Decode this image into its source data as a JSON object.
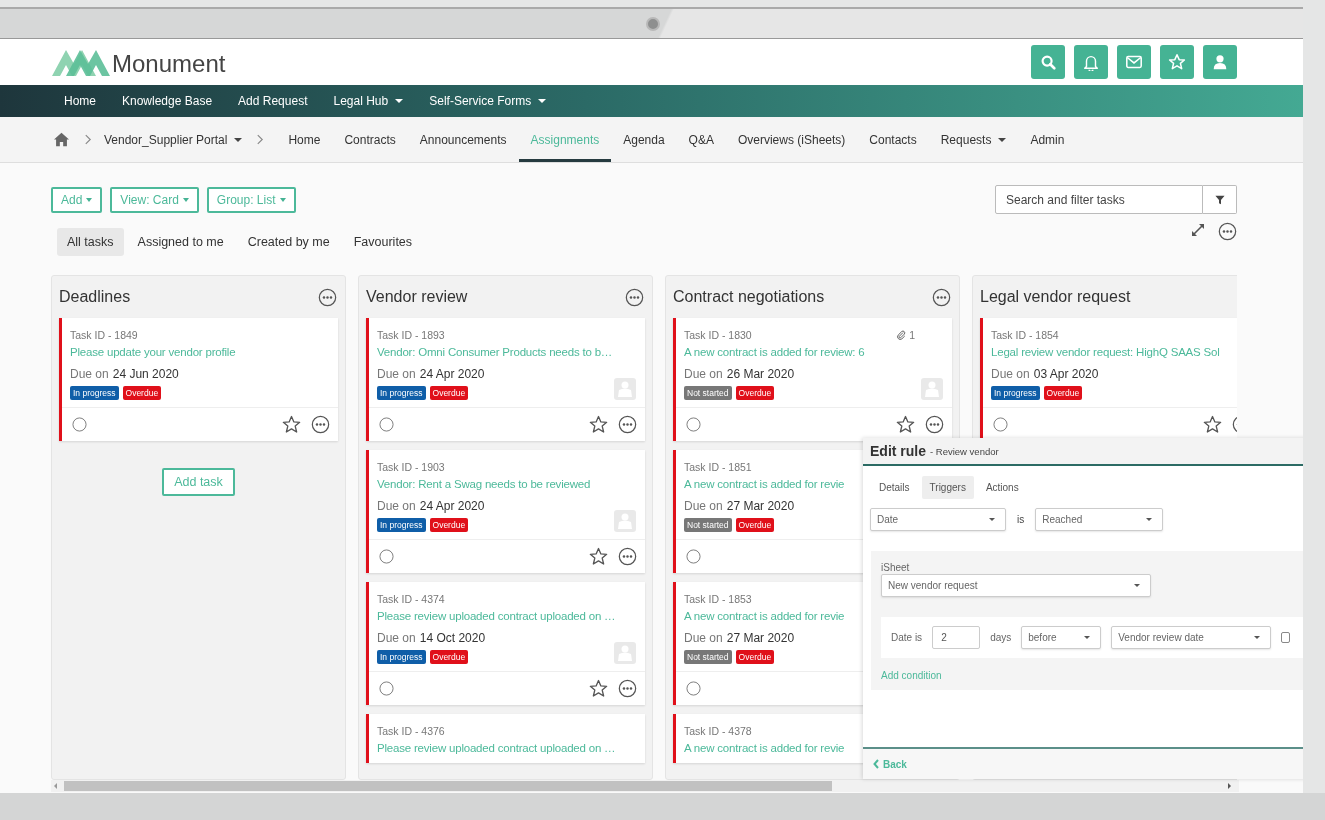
{
  "header": {
    "logo_text": "Monument",
    "icons": [
      {
        "kind": "search"
      },
      {
        "kind": "bell"
      },
      {
        "kind": "mail"
      },
      {
        "kind": "star"
      },
      {
        "kind": "user"
      }
    ]
  },
  "navbar": {
    "items": [
      {
        "label": "Home",
        "dropdown": false
      },
      {
        "label": "Knowledge Base",
        "dropdown": false
      },
      {
        "label": "Add Request",
        "dropdown": false
      },
      {
        "label": "Legal Hub",
        "dropdown": true
      },
      {
        "label": "Self-Service Forms",
        "dropdown": true
      }
    ]
  },
  "breadcrumb": {
    "portal": "Vendor_Supplier Portal",
    "tabs": [
      {
        "label": "Home",
        "selected": false,
        "dropdown": false
      },
      {
        "label": "Contracts",
        "selected": false,
        "dropdown": false
      },
      {
        "label": "Announcements",
        "selected": false,
        "dropdown": false
      },
      {
        "label": "Assignments",
        "selected": true,
        "dropdown": false
      },
      {
        "label": "Agenda",
        "selected": false,
        "dropdown": false
      },
      {
        "label": "Q&A",
        "selected": false,
        "dropdown": false
      },
      {
        "label": "Overviews (iSheets)",
        "selected": false,
        "dropdown": false
      },
      {
        "label": "Contacts",
        "selected": false,
        "dropdown": false
      },
      {
        "label": "Requests",
        "selected": false,
        "dropdown": true
      },
      {
        "label": "Admin",
        "selected": false,
        "dropdown": false
      }
    ]
  },
  "toolbar": {
    "buttons": [
      "Add",
      "View: Card",
      "Group: List"
    ],
    "search": {
      "placeholder": "Search and filter tasks"
    }
  },
  "filter_tabs": [
    {
      "label": "All tasks",
      "selected": true
    },
    {
      "label": "Assigned to me",
      "selected": false
    },
    {
      "label": "Created by me",
      "selected": false
    },
    {
      "label": "Favourites",
      "selected": false
    }
  ],
  "columns": [
    {
      "title": "Deadlines",
      "menu": true,
      "add_task": "Add task",
      "cards": [
        {
          "task_id": "Task ID - 1849",
          "title": "Please update your vendor profile",
          "due_label": "Due on",
          "due": "24 Jun 2020",
          "tags": [
            {
              "kind": "in_progress",
              "label": "In progress"
            },
            {
              "kind": "overdue",
              "label": "Overdue"
            }
          ],
          "avatar": false,
          "footer": true,
          "done": false
        }
      ]
    },
    {
      "title": "Vendor review",
      "menu": true,
      "cards": [
        {
          "task_id": "Task ID - 1893",
          "title": "Vendor: Omni Consumer Products needs to b…",
          "due_label": "Due on",
          "due": "24 Apr 2020",
          "tags": [
            {
              "kind": "in_progress",
              "label": "In progress"
            },
            {
              "kind": "overdue",
              "label": "Overdue"
            }
          ],
          "avatar": true,
          "footer": true,
          "done": false
        },
        {
          "task_id": "Task ID - 1903",
          "title": "Vendor: Rent a Swag needs to be reviewed",
          "due_label": "Due on",
          "due": "24 Apr 2020",
          "tags": [
            {
              "kind": "in_progress",
              "label": "In progress"
            },
            {
              "kind": "overdue",
              "label": "Overdue"
            }
          ],
          "avatar": true,
          "footer": true,
          "done": false
        },
        {
          "task_id": "Task ID - 4374",
          "title": "Please review uploaded contract uploaded on …",
          "due_label": "Due on",
          "due": "14 Oct 2020",
          "tags": [
            {
              "kind": "in_progress",
              "label": "In progress"
            },
            {
              "kind": "overdue",
              "label": "Overdue"
            }
          ],
          "avatar": true,
          "footer": true,
          "done": false
        },
        {
          "task_id": "Task ID - 4376",
          "title": "Please review uploaded contract uploaded on …"
        }
      ]
    },
    {
      "title": "Contract negotiations",
      "menu": true,
      "cards": [
        {
          "task_id": "Task ID - 1830",
          "attachments": "1",
          "title": "A new contract is added for review: 6",
          "due_label": "Due on",
          "due": "26 Mar 2020",
          "tags": [
            {
              "kind": "not_started",
              "label": "Not started"
            },
            {
              "kind": "overdue",
              "label": "Overdue"
            }
          ],
          "avatar": true,
          "footer": true,
          "done": false
        },
        {
          "task_id": "Task ID - 1851",
          "title": "A new contract is added for revie",
          "due_label": "Due on",
          "due": "27 Mar 2020",
          "tags": [
            {
              "kind": "not_started",
              "label": "Not started"
            },
            {
              "kind": "overdue",
              "label": "Overdue"
            }
          ],
          "avatar": false,
          "footer": true,
          "done": false
        },
        {
          "task_id": "Task ID - 1853",
          "title": "A new contract is added for revie",
          "due_label": "Due on",
          "due": "27 Mar 2020",
          "tags": [
            {
              "kind": "not_started",
              "label": "Not started"
            },
            {
              "kind": "overdue",
              "label": "Overdue"
            }
          ],
          "avatar": false,
          "footer": true,
          "done": false
        },
        {
          "task_id": "Task ID - 4378",
          "title": "A new contract is added for revie"
        }
      ]
    },
    {
      "title": "Legal vendor request",
      "menu": false,
      "cards": [
        {
          "task_id": "Task ID - 1854",
          "title": "Legal review vendor request: HighQ SAAS Sol",
          "due_label": "Due on",
          "due": "03 Apr 2020",
          "tags": [
            {
              "kind": "in_progress",
              "label": "In progress"
            },
            {
              "kind": "overdue",
              "label": "Overdue"
            }
          ],
          "avatar": false,
          "footer": true,
          "done": false
        }
      ]
    }
  ],
  "edit_rule": {
    "title": "Edit rule",
    "subtitle": "- Review vendor",
    "tabs": [
      {
        "label": "Details",
        "selected": false
      },
      {
        "label": "Triggers",
        "selected": true
      },
      {
        "label": "Actions",
        "selected": false
      }
    ],
    "trigger": {
      "field": "Date",
      "operator": "is",
      "value": "Reached"
    },
    "isheet_label": "iSheet",
    "isheet": "New vendor request",
    "condition": {
      "label": "Date is",
      "amount": "2",
      "unit": "days",
      "direction": "before",
      "reference": "Vendor review date",
      "checked": false
    },
    "add_condition": "Add condition",
    "back": "Back"
  }
}
